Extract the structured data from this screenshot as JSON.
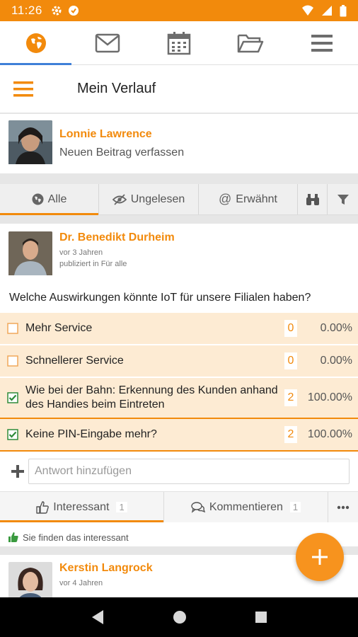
{
  "status_bar": {
    "time": "11:26"
  },
  "top_nav": {
    "tabs": [
      "globe",
      "mail",
      "calendar",
      "folder",
      "menu"
    ],
    "active": "globe"
  },
  "page_header": {
    "title": "Mein Verlauf"
  },
  "composer": {
    "user": "Lonnie Lawrence",
    "prompt": "Neuen Beitrag verfassen"
  },
  "filters": {
    "all": "Alle",
    "unread": "Ungelesen",
    "mentioned": "Erwähnt"
  },
  "post": {
    "author": "Dr. Benedikt Durheim",
    "time": "vor 3 Jahren",
    "published": "publiziert in Für alle",
    "question": "Welche Auswirkungen könnte IoT für unsere Filialen haben?",
    "options": [
      {
        "text": "Mehr Service",
        "count": "0",
        "percent": "0.00%",
        "checked": false
      },
      {
        "text": "Schnellerer Service",
        "count": "0",
        "percent": "0.00%",
        "checked": false
      },
      {
        "text": "Wie bei der Bahn: Erkennung des Kunden anhand des Handies beim Eintreten",
        "count": "2",
        "percent": "100.00%",
        "checked": true
      },
      {
        "text": "Keine PIN-Eingabe mehr?",
        "count": "2",
        "percent": "100.00%",
        "checked": true
      }
    ],
    "answer_placeholder": "Antwort hinzufügen",
    "actions": {
      "like_label": "Interessant",
      "like_count": "1",
      "comment_label": "Kommentieren",
      "comment_count": "1"
    },
    "likes_text": "Sie finden das interessant"
  },
  "post2": {
    "author": "Kerstin Langrock",
    "time": "vor 4 Jahren"
  },
  "colors": {
    "accent": "#f28a0c",
    "option_bg": "#fdebd3",
    "check": "#2e8b3a"
  }
}
